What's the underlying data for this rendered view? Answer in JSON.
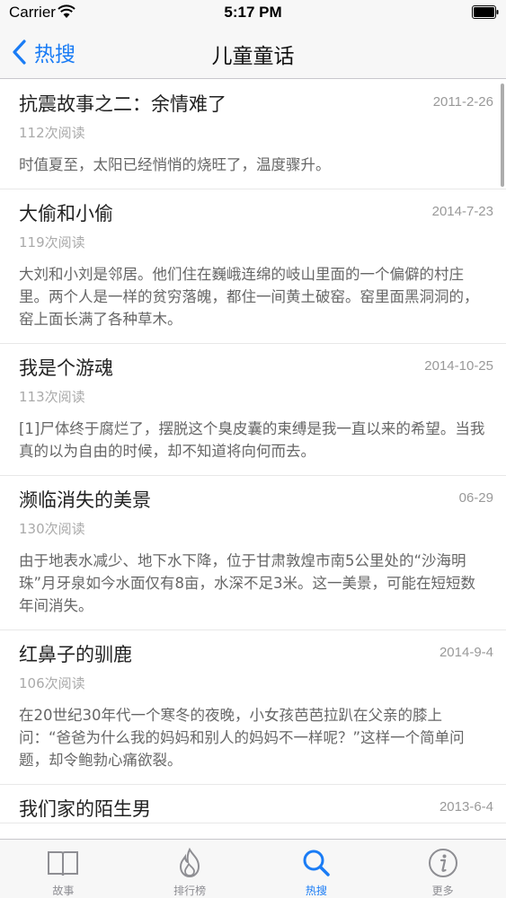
{
  "status_bar": {
    "carrier": "Carrier",
    "time": "5:17 PM"
  },
  "nav": {
    "back_label": "热搜",
    "title": "儿童童话"
  },
  "items": [
    {
      "title": "抗震故事之二：余情难了",
      "date": "2011-2-26",
      "reads": "112次阅读",
      "summary": "时值夏至，太阳已经悄悄的烧旺了，温度骤升。"
    },
    {
      "title": "大偷和小偷",
      "date": "2014-7-23",
      "reads": "119次阅读",
      "summary": "大刘和小刘是邻居。他们住在巍峨连绵的岐山里面的一个偏僻的村庄里。两个人是一样的贫穷落魄，都住一间黄土破窑。窑里面黑洞洞的，窑上面长满了各种草木。"
    },
    {
      "title": "我是个游魂",
      "date": "2014-10-25",
      "reads": "113次阅读",
      "summary": "[1]尸体终于腐烂了，摆脱这个臭皮囊的束缚是我一直以来的希望。当我真的以为自由的时候，却不知道将向何而去。"
    },
    {
      "title": "濒临消失的美景",
      "date": "06-29",
      "reads": "130次阅读",
      "summary": "由于地表水减少、地下水下降，位于甘肃敦煌市南5公里处的“沙海明珠”月牙泉如今水面仅有8亩，水深不足3米。这一美景，可能在短短数年间消失。"
    },
    {
      "title": "红鼻子的驯鹿",
      "date": "2014-9-4",
      "reads": "106次阅读",
      "summary": "在20世纪30年代一个寒冬的夜晚，小女孩芭芭拉趴在父亲的膝上问：“爸爸为什么我的妈妈和别人的妈妈不一样呢？”这样一个简单问题，却令鲍勃心痛欲裂。"
    },
    {
      "title": "我们家的陌生男",
      "date": "2013-6-4",
      "reads": "",
      "summary": ""
    }
  ],
  "tabs": [
    {
      "label": "故事",
      "icon": "book-icon",
      "active": false
    },
    {
      "label": "排行榜",
      "icon": "flame-icon",
      "active": false
    },
    {
      "label": "热搜",
      "icon": "search-icon",
      "active": true
    },
    {
      "label": "更多",
      "icon": "info-icon",
      "active": false
    }
  ],
  "colors": {
    "accent": "#1a7cf5",
    "inactive": "#8e8e93"
  }
}
